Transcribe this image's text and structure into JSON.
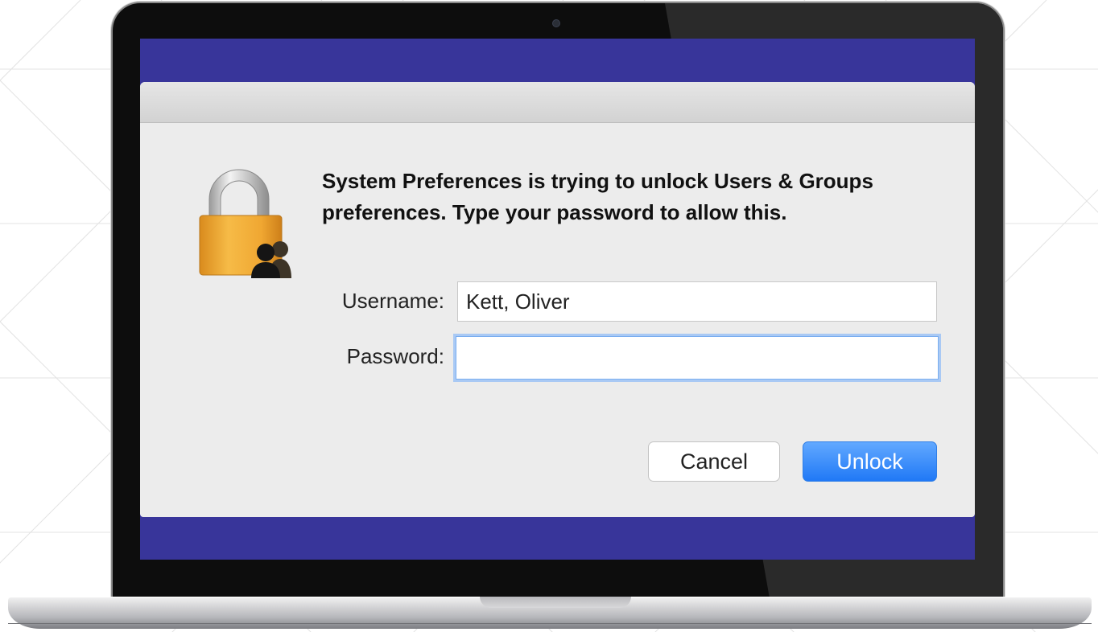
{
  "dialog": {
    "message": "System Preferences is trying to unlock Users & Groups preferences. Type your password to allow this.",
    "icon": "lock-users-icon",
    "username_label": "Username:",
    "username_value": "Kett, Oliver",
    "password_label": "Password:",
    "password_value": "",
    "cancel_label": "Cancel",
    "unlock_label": "Unlock"
  },
  "colors": {
    "screen_background": "#38359a",
    "dialog_background": "#ececec",
    "accent": "#2079f6"
  }
}
